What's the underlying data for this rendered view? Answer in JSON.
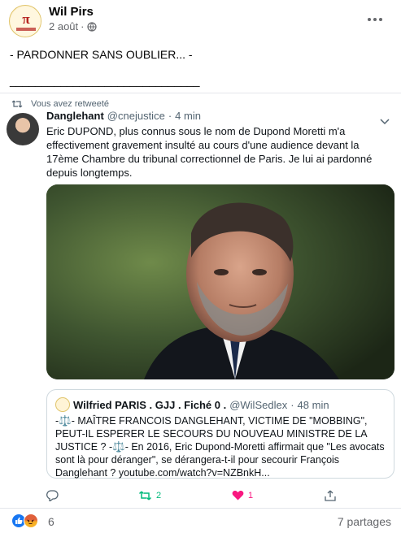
{
  "post": {
    "author": "Wil Pirs",
    "date": "2 août",
    "separator": "·",
    "text_line1": "- PARDONNER SANS OUBLIER... -",
    "text_line2": "______________________________"
  },
  "embedded_tweet": {
    "retweet_label": "Vous avez retweeté",
    "name": "Danglehant",
    "handle": "@cnejustice",
    "separator": "·",
    "time": "4 min",
    "text": "Eric DUPOND, plus connus sous le nom de Dupond Moretti m'a effectivement gravement insulté au cours d'une audience devant la 17ème Chambre du tribunal correctionnel de Paris. Je lui ai pardonné depuis longtemps.",
    "quote": {
      "name": "Wilfried PARIS . GJJ . Fiché 0 .",
      "handle": "@WilSedlex",
      "separator": "·",
      "time": "48 min",
      "text": "-⚖️- MAÎTRE FRANCOIS DANGLEHANT, VICTIME DE \"MOBBING\", PEUT-IL ESPERER LE SECOURS DU NOUVEAU MINISTRE DE LA JUSTICE ? -⚖️- En 2016, Eric Dupond-Moretti affirmait que \"Les avocats sont là pour déranger\", se dérangera-t-il pour secourir François Danglehant ? youtube.com/watch?v=NZBnkH..."
    },
    "actions": {
      "retweets": "2",
      "likes": "1"
    }
  },
  "footer": {
    "reaction_count": "6",
    "shares": "7 partages"
  },
  "colors": {
    "facebook_blue": "#1877f2",
    "retweet_green": "#00ba7c",
    "like_pink": "#f91880",
    "muted": "#65676b"
  }
}
